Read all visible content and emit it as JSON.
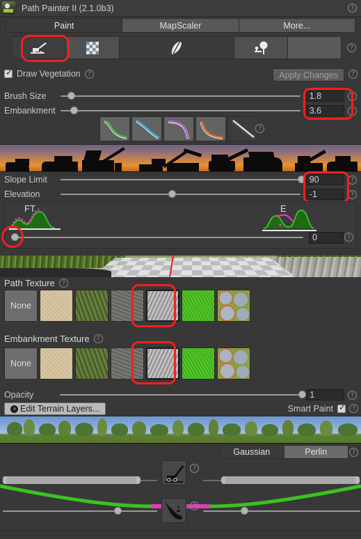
{
  "window": {
    "title": "Path Painter II (2.1.0b3)",
    "logo_icon": "path-painter-logo",
    "help_icon": "help-icon"
  },
  "tabs": [
    {
      "label": "Paint",
      "active": true
    },
    {
      "label": "MapScaler",
      "active": false
    },
    {
      "label": "More...",
      "active": false
    }
  ],
  "mode_toolbar": {
    "items": [
      {
        "icon": "excavator-icon",
        "selected": true,
        "highlighted": true
      },
      {
        "icon": "checker-texture-icon",
        "selected": false
      },
      {
        "icon": "feather-brush-icon",
        "selected": false
      },
      {
        "icon": "tree-stamp-icon",
        "selected": false
      },
      {
        "icon": "blank-icon",
        "selected": false
      }
    ]
  },
  "vegetation": {
    "checkbox_label": "Draw Vegetation",
    "checked": true,
    "apply_button": "Apply Changes",
    "apply_enabled": false
  },
  "brush": {
    "size": {
      "label": "Brush Size",
      "value": "1.8",
      "knob_pct": 3
    },
    "embankment": {
      "label": "Embankment",
      "value": "3.6",
      "knob_pct": 4
    },
    "profiles": [
      {
        "name": "curve-green",
        "color": "#3bb82e",
        "selected": false
      },
      {
        "name": "curve-blue",
        "color": "#37a6de",
        "selected": false
      },
      {
        "name": "curve-purple",
        "color": "#b45ad8",
        "selected": false
      },
      {
        "name": "curve-orange",
        "color": "#e0661c",
        "selected": false
      },
      {
        "name": "curve-linear",
        "color": "#e8e8e8",
        "selected": true
      }
    ]
  },
  "terrain": {
    "slope_limit": {
      "label": "Slope Limit",
      "value": "90",
      "knob_pct": 99
    },
    "elevation": {
      "label": "Elevation",
      "value": "-1",
      "knob_pct": 45
    },
    "histogram": {
      "left_label": "FT",
      "right_label": "E",
      "slider_value": "0",
      "slider_knob_pct": 1,
      "curve_color": "#3bb82e",
      "dotted_color": "#ff2fbb"
    }
  },
  "path_texture": {
    "label": "Path Texture",
    "swatches": [
      {
        "name": "none",
        "label": "None",
        "selected": false
      },
      {
        "name": "sand",
        "label": "",
        "selected": false
      },
      {
        "name": "grass-dirt",
        "label": "",
        "selected": false
      },
      {
        "name": "dark-gravel",
        "label": "",
        "selected": false
      },
      {
        "name": "light-rock",
        "label": "",
        "selected": true
      },
      {
        "name": "bright-green",
        "label": "",
        "selected": false
      },
      {
        "name": "cobblestone",
        "label": "",
        "selected": false
      }
    ]
  },
  "embankment_texture": {
    "label": "Embankment Texture",
    "swatches": [
      {
        "name": "none",
        "label": "None",
        "selected": false
      },
      {
        "name": "sand",
        "label": "",
        "selected": false
      },
      {
        "name": "grass-dirt",
        "label": "",
        "selected": false
      },
      {
        "name": "dark-gravel",
        "label": "",
        "selected": false
      },
      {
        "name": "light-rock",
        "label": "",
        "selected": true
      },
      {
        "name": "bright-green",
        "label": "",
        "selected": false
      },
      {
        "name": "cobblestone",
        "label": "",
        "selected": false
      }
    ]
  },
  "opacity": {
    "label": "Opacity",
    "value": "1",
    "knob_pct": 99
  },
  "terrain_layers_button": "Edit Terrain Layers...",
  "smart_paint": {
    "label": "Smart Paint",
    "checked": true
  },
  "noise": {
    "gaussian_label": "Gaussian",
    "perlin_label": "Perlin",
    "selected": "Perlin"
  },
  "profile_editor": {
    "top_icon": "mower-ramp-icon",
    "bottom_icon": "brush-stroke-icon",
    "path_color": "#e23bbd",
    "embankment_color": "#3cc21f",
    "left_minmax_fill_pct": 78,
    "right_minmax_fill_pct": 85,
    "left_knob_pct": 32,
    "right_knob_pct": 24
  },
  "colors": {
    "background": "#383838",
    "panel": "#3a3a3a",
    "accent_red": "#f41f1f",
    "text": "#c9c9c9"
  }
}
